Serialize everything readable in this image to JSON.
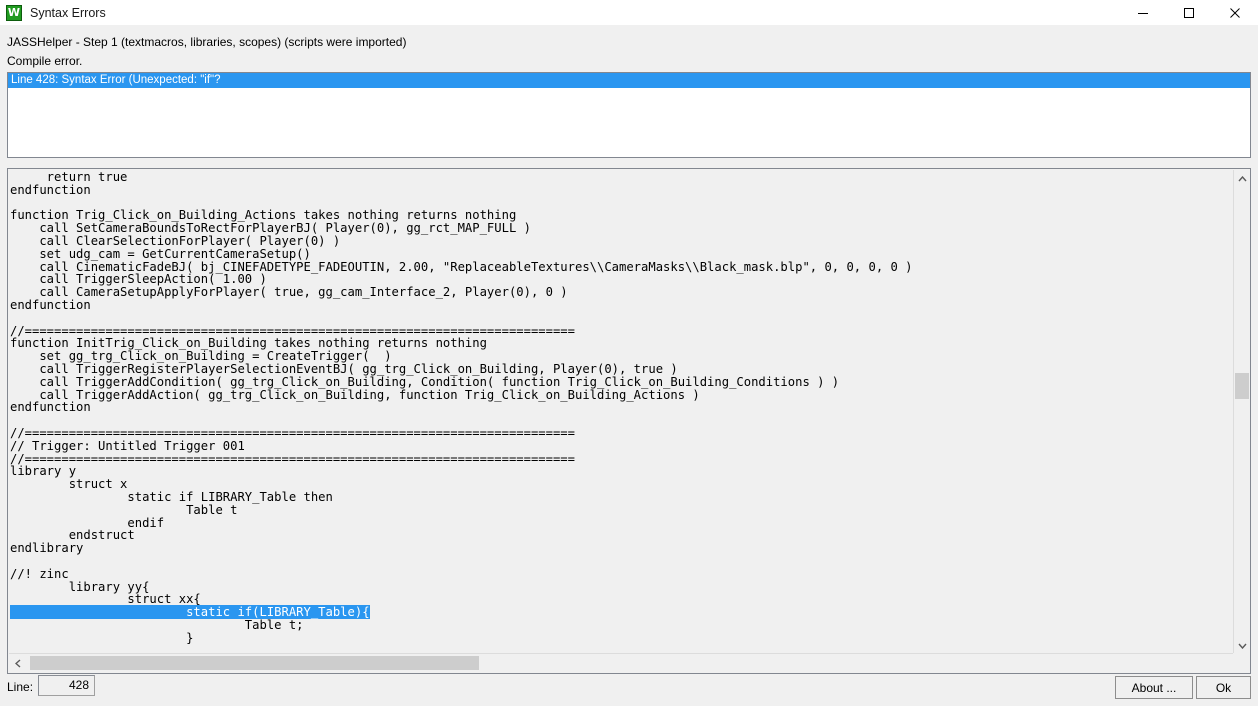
{
  "window": {
    "title": "Syntax Errors",
    "icon": "jasshelper-icon",
    "controls": {
      "minimize": "minimize-icon",
      "maximize": "maximize-icon",
      "close": "close-icon"
    }
  },
  "status": {
    "step_line": "JASSHelper - Step 1 (textmacros, libraries, scopes) (scripts were imported)",
    "compile_line": "Compile error."
  },
  "errors": {
    "items": [
      {
        "text": "Line 428: Syntax Error (Unexpected: \"if\"?",
        "selected": true
      }
    ]
  },
  "code": {
    "lines": [
      "     return true",
      "endfunction",
      "",
      "function Trig_Click_on_Building_Actions takes nothing returns nothing",
      "    call SetCameraBoundsToRectForPlayerBJ( Player(0), gg_rct_MAP_FULL )",
      "    call ClearSelectionForPlayer( Player(0) )",
      "    set udg_cam = GetCurrentCameraSetup()",
      "    call CinematicFadeBJ( bj_CINEFADETYPE_FADEOUTIN, 2.00, \"ReplaceableTextures\\\\CameraMasks\\\\Black_mask.blp\", 0, 0, 0, 0 )",
      "    call TriggerSleepAction( 1.00 )",
      "    call CameraSetupApplyForPlayer( true, gg_cam_Interface_2, Player(0), 0 )",
      "endfunction",
      "",
      "//===========================================================================",
      "function InitTrig_Click_on_Building takes nothing returns nothing",
      "    set gg_trg_Click_on_Building = CreateTrigger(  )",
      "    call TriggerRegisterPlayerSelectionEventBJ( gg_trg_Click_on_Building, Player(0), true )",
      "    call TriggerAddCondition( gg_trg_Click_on_Building, Condition( function Trig_Click_on_Building_Conditions ) )",
      "    call TriggerAddAction( gg_trg_Click_on_Building, function Trig_Click_on_Building_Actions )",
      "endfunction",
      "",
      "//===========================================================================",
      "// Trigger: Untitled Trigger 001",
      "//===========================================================================",
      "library y",
      "        struct x",
      "                static if LIBRARY_Table then",
      "                        Table t",
      "                endif",
      "        endstruct",
      "endlibrary",
      "",
      "//! zinc",
      "        library yy{",
      "                struct xx{",
      "                        static if(LIBRARY_Table){",
      "                                Table t;",
      "                        }"
    ],
    "selected_line_index": 34,
    "selected_text": "                        static if(LIBRARY_Table){",
    "selection_color": "#2a96f0"
  },
  "footer": {
    "line_label": "Line:",
    "line_value": "428",
    "about_label": "About ...",
    "ok_label": "Ok"
  },
  "colors": {
    "dialog_background": "#f0f0f0",
    "titlebar_background": "#ffffff",
    "selection_blue": "#2a96f0",
    "icon_green": "#1f9b1f",
    "scrollbar_thumb": "#cdcdcd",
    "border": "#828790"
  }
}
